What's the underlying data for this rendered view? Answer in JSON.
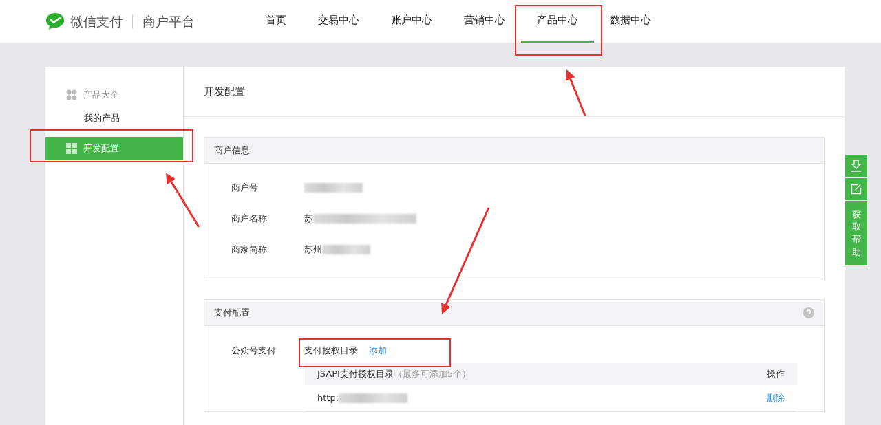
{
  "header": {
    "brand": "微信支付",
    "subtitle": "商户平台"
  },
  "nav": [
    {
      "label": "首页",
      "selected": false
    },
    {
      "label": "交易中心",
      "selected": false
    },
    {
      "label": "账户中心",
      "selected": false
    },
    {
      "label": "营销中心",
      "selected": false
    },
    {
      "label": "产品中心",
      "selected": true
    },
    {
      "label": "数据中心",
      "selected": false
    }
  ],
  "sidebar": {
    "items": [
      {
        "kind": "group",
        "label": "产品大全",
        "selected": false
      },
      {
        "kind": "link",
        "label": "我的产品",
        "selected": false
      },
      {
        "kind": "group",
        "label": "开发配置",
        "selected": true
      }
    ]
  },
  "page_title": "开发配置",
  "merchant_info": {
    "title": "商户信息",
    "fields": [
      {
        "label": "商户号"
      },
      {
        "label": "商户名称",
        "value": "苏"
      },
      {
        "label": "商家简称",
        "value": "苏州"
      }
    ]
  },
  "payment_config": {
    "title": "支付配置",
    "row_label": "公众号支付",
    "link_label": "支付授权目录",
    "add_link": "添加",
    "table": {
      "columns": [
        {
          "label": "JSAPI支付授权目录",
          "note": "（最多可添加5个）"
        },
        {
          "label": "操作"
        }
      ],
      "rows": [
        {
          "url": "http:",
          "action": "删除"
        }
      ]
    }
  },
  "help_widget": {
    "label": "获取帮助"
  }
}
